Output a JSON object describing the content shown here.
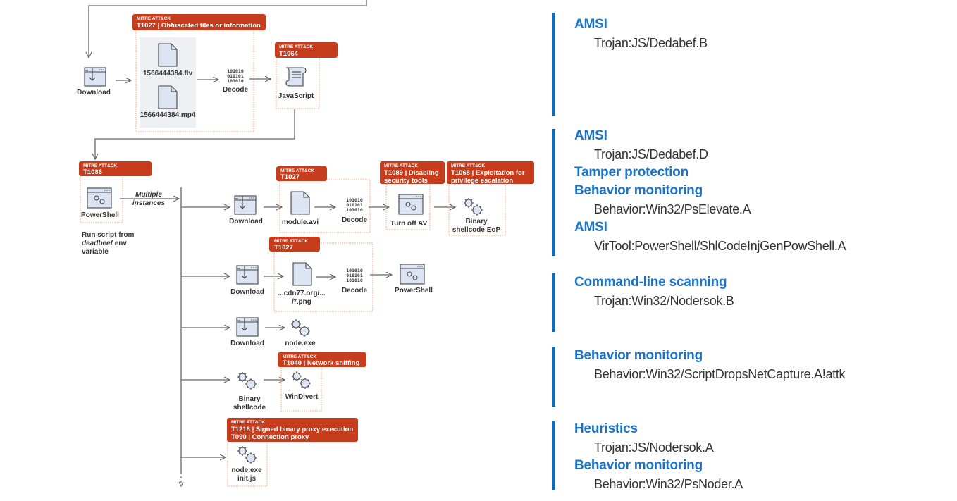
{
  "colors": {
    "tag_bg": "#c63d1e",
    "frame": "#f3b49a",
    "icon_fill": "#dde5f4",
    "side_accent": "#0f6cbd",
    "category_text": "#1a73c7"
  },
  "diagram": {
    "mitre_label": "MITRE ATT&CK",
    "row1": {
      "download": {
        "label": "Download",
        "icon": "download-window-icon"
      },
      "obfuscated_tag": "T1027 | Obfuscated files or information",
      "file1": {
        "label": "1566444384.flv",
        "icon": "file-icon"
      },
      "file2": {
        "label": "1566444384.mp4",
        "icon": "file-icon"
      },
      "decode": {
        "label": "Decode",
        "binary": [
          "101010",
          "010101",
          "101010"
        ],
        "icon": "binary-icon"
      },
      "js_tag": "T1064",
      "javascript": {
        "label": "JavaScript",
        "icon": "script-scroll-icon"
      }
    },
    "row2": {
      "ps_tag": "T1086",
      "powershell": {
        "label": "PowerShell",
        "icon": "powershell-window-icon"
      },
      "ps_note": [
        "Run script from",
        "deadbeef",
        "env",
        "variable"
      ],
      "multiple_instances": [
        "Multiple",
        "instances"
      ]
    },
    "branch1": {
      "download": "Download",
      "tag1": "T1027",
      "file": "module.avi",
      "decode": "Decode",
      "tag2": [
        "T1089 | Disabling",
        "security tools"
      ],
      "turn_off_av": "Turn off AV",
      "tag3": [
        "T1068 | Exploitation for",
        "privilege escalation"
      ],
      "eop": [
        "Binary",
        "shellcode EoP"
      ]
    },
    "branch2": {
      "download": "Download",
      "tag": "T1027",
      "file": [
        "...cdn77.org/...",
        "/*.png"
      ],
      "decode": "Decode",
      "powershell": "PowerShell"
    },
    "branch3": {
      "download": "Download",
      "node": "node.exe"
    },
    "branch4": {
      "shellcode": [
        "Binary",
        "shellcode"
      ],
      "tag": "T1040 | Network sniffing",
      "windivert": "WinDivert"
    },
    "branch5": {
      "tag": [
        "T1218 | Signed binary proxy execution",
        "T090 | Connection proxy"
      ],
      "node": [
        "node.exe",
        "init.js"
      ]
    }
  },
  "detections": [
    {
      "items": [
        {
          "category": "AMSI",
          "detail": "Trojan:JS/Dedabef.B"
        }
      ]
    },
    {
      "items": [
        {
          "category": "AMSI",
          "detail": "Trojan:JS/Dedabef.D"
        },
        {
          "category": "Tamper protection",
          "detail": null
        },
        {
          "category": "Behavior monitoring",
          "detail": "Behavior:Win32/PsElevate.A"
        },
        {
          "category": "AMSI",
          "detail": "VirTool:PowerShell/ShlCodeInjGenPowShell.A"
        }
      ]
    },
    {
      "items": [
        {
          "category": "Command-line scanning",
          "detail": "Trojan:Win32/Nodersok.B"
        }
      ]
    },
    {
      "items": [
        {
          "category": "Behavior monitoring",
          "detail": "Behavior:Win32/ScriptDropsNetCapture.A!attk"
        }
      ]
    },
    {
      "items": [
        {
          "category": "Heuristics",
          "detail": "Trojan:JS/Nodersok.A"
        },
        {
          "category": "Behavior monitoring",
          "detail": "Behavior:Win32/PsNoder.A"
        }
      ]
    }
  ]
}
